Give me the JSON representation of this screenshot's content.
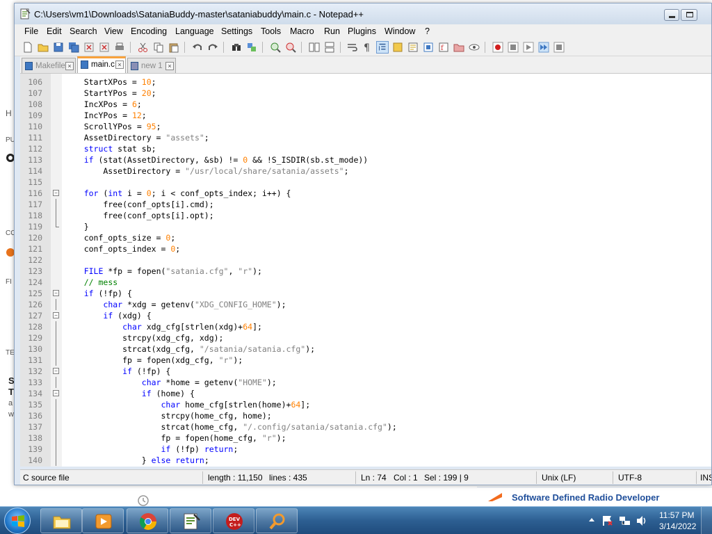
{
  "window": {
    "title": "C:\\Users\\vm1\\Downloads\\SataniaBuddy-master\\sataniabuddy\\main.c - Notepad++"
  },
  "menu": [
    "File",
    "Edit",
    "Search",
    "View",
    "Encoding",
    "Language",
    "Settings",
    "Tools",
    "Macro",
    "Run",
    "Plugins",
    "Window",
    "?"
  ],
  "tabs": [
    {
      "label": "Makefile",
      "active": false
    },
    {
      "label": "main.c",
      "active": true
    },
    {
      "label": "new 1",
      "active": false
    }
  ],
  "editor": {
    "lines": [
      {
        "n": "106",
        "code": "    StartXPos = 10;"
      },
      {
        "n": "107",
        "code": "    StartYPos = 20;"
      },
      {
        "n": "108",
        "code": "    IncXPos = 6;"
      },
      {
        "n": "109",
        "code": "    IncYPos = 12;"
      },
      {
        "n": "110",
        "code": "    ScrollYPos = 95;"
      },
      {
        "n": "111",
        "code": "    AssetDirectory = \"assets\";"
      },
      {
        "n": "112",
        "code": "    struct stat sb;"
      },
      {
        "n": "113",
        "code": "    if (stat(AssetDirectory, &sb) != 0 && !S_ISDIR(sb.st_mode))"
      },
      {
        "n": "114",
        "code": "        AssetDirectory = \"/usr/local/share/satania/assets\";"
      },
      {
        "n": "115",
        "code": ""
      },
      {
        "n": "116",
        "code": "    for (int i = 0; i < conf_opts_index; i++) {"
      },
      {
        "n": "117",
        "code": "        free(conf_opts[i].cmd);"
      },
      {
        "n": "118",
        "code": "        free(conf_opts[i].opt);"
      },
      {
        "n": "119",
        "code": "    }"
      },
      {
        "n": "120",
        "code": "    conf_opts_size = 0;"
      },
      {
        "n": "121",
        "code": "    conf_opts_index = 0;"
      },
      {
        "n": "122",
        "code": ""
      },
      {
        "n": "123",
        "code": "    FILE *fp = fopen(\"satania.cfg\", \"r\");"
      },
      {
        "n": "124",
        "code": "    // mess"
      },
      {
        "n": "125",
        "code": "    if (!fp) {"
      },
      {
        "n": "126",
        "code": "        char *xdg = getenv(\"XDG_CONFIG_HOME\");"
      },
      {
        "n": "127",
        "code": "        if (xdg) {"
      },
      {
        "n": "128",
        "code": "            char xdg_cfg[strlen(xdg)+64];"
      },
      {
        "n": "129",
        "code": "            strcpy(xdg_cfg, xdg);"
      },
      {
        "n": "130",
        "code": "            strcat(xdg_cfg, \"/satania/satania.cfg\");"
      },
      {
        "n": "131",
        "code": "            fp = fopen(xdg_cfg, \"r\");"
      },
      {
        "n": "132",
        "code": "            if (!fp) {"
      },
      {
        "n": "133",
        "code": "                char *home = getenv(\"HOME\");"
      },
      {
        "n": "134",
        "code": "                if (home) {"
      },
      {
        "n": "135",
        "code": "                    char home_cfg[strlen(home)+64];"
      },
      {
        "n": "136",
        "code": "                    strcpy(home_cfg, home);"
      },
      {
        "n": "137",
        "code": "                    strcat(home_cfg, \"/.config/satania/satania.cfg\");"
      },
      {
        "n": "138",
        "code": "                    fp = fopen(home_cfg, \"r\");"
      },
      {
        "n": "139",
        "code": "                    if (!fp) return;"
      },
      {
        "n": "140",
        "code": "                } else return;"
      }
    ]
  },
  "status": {
    "file_type": "C source file",
    "length": "length : 11,150",
    "lines": "lines : 435",
    "ln": "Ln : 74",
    "col": "Col : 1",
    "sel": "Sel : 199 | 9",
    "eol": "Unix (LF)",
    "encoding": "UTF-8",
    "ins": "INS"
  },
  "background": {
    "banner_text": "Software Defined Radio Developer",
    "fragments": [
      "H",
      "PU",
      "CO",
      "FI",
      "TE",
      "S",
      "T",
      "a",
      "w"
    ]
  },
  "taskbar": {
    "time": "11:57 PM",
    "date": "3/14/2022"
  },
  "colors": {
    "keyword": "#0000ff",
    "number": "#ff8000",
    "string": "#808080",
    "comment": "#008000",
    "active_tab_accent": "#f8a23c"
  }
}
